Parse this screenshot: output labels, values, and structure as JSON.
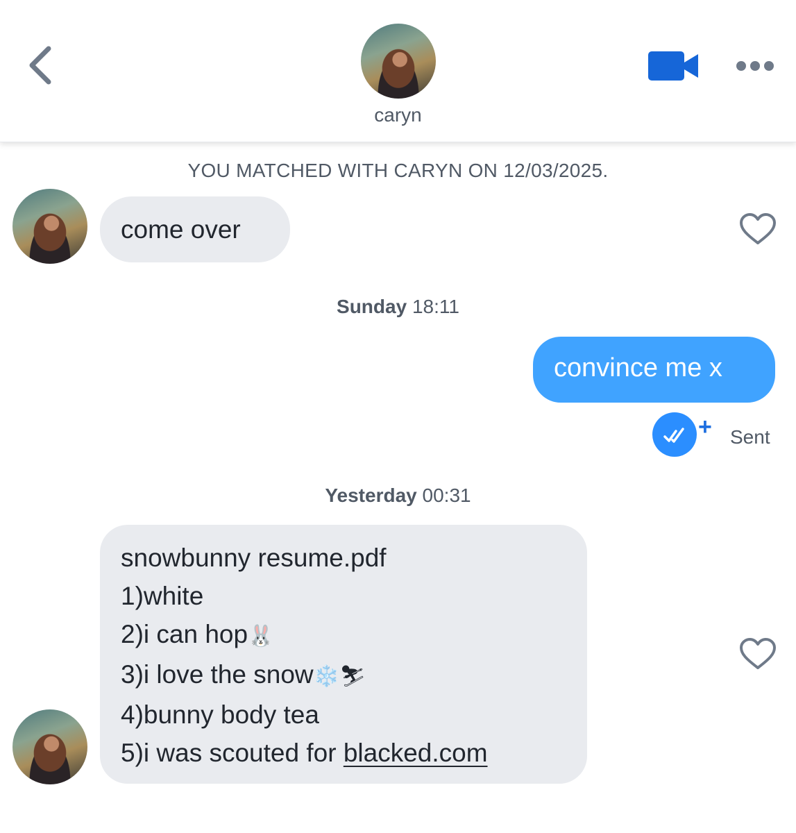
{
  "header": {
    "name": "caryn",
    "icons": {
      "back": "chevron-left-icon",
      "video": "video-camera-icon",
      "more": "more-horizontal-icon"
    },
    "accent_color": "#1666d8"
  },
  "match_banner": "YOU MATCHED WITH CARYN ON 12/03/2025.",
  "messages": {
    "m1": {
      "text": "come over"
    },
    "ts1": {
      "day": "Sunday",
      "time": "18:11"
    },
    "m2": {
      "text": "convince me x",
      "status": "Sent"
    },
    "ts2": {
      "day": "Yesterday",
      "time": "00:31"
    },
    "m3": {
      "lines": [
        "snowbunny resume.pdf",
        "1)white",
        "2)i can hop",
        "3)i love the snow",
        "4)bunny body tea",
        "5)i was scouted for "
      ],
      "emoji_rabbit": "🐰",
      "emoji_snow": "❄️",
      "emoji_ski": "⛷",
      "link": "blacked.com"
    }
  },
  "colors": {
    "incoming_bubble": "#e9ebef",
    "outgoing_bubble": "#40a3ff",
    "read_badge": "#2b8eff"
  }
}
